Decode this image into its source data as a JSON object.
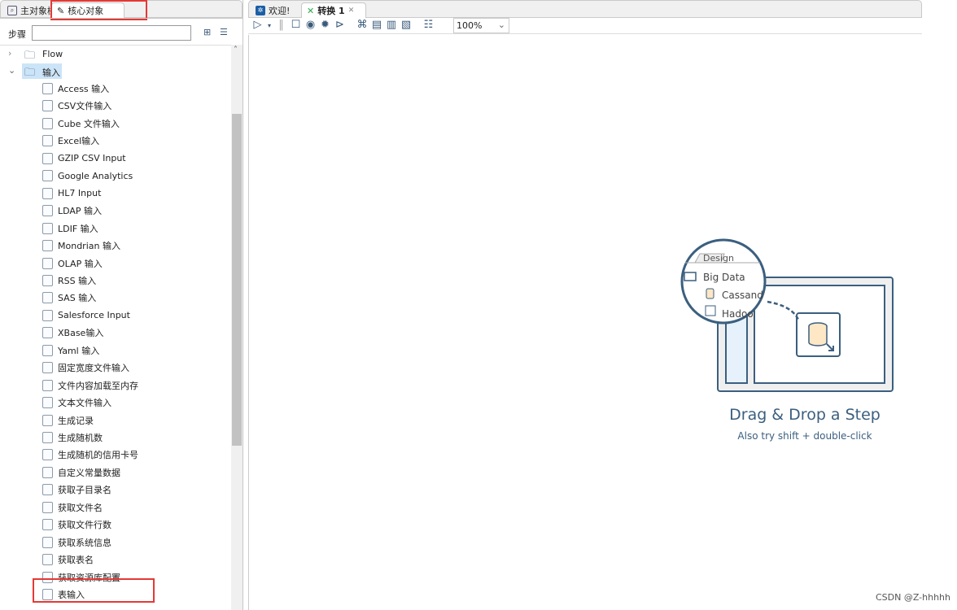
{
  "left_panel": {
    "tabs": [
      {
        "label": "主对象树",
        "icon": "search-doc-icon"
      },
      {
        "label": "核心对象",
        "icon": "pencil-icon"
      }
    ],
    "search_label": "步骤",
    "search_value": "",
    "tree": {
      "folders": [
        {
          "label": "Flow",
          "expanded": false
        },
        {
          "label": "输入",
          "expanded": true
        }
      ],
      "items": [
        "Access 输入",
        "CSV文件输入",
        "Cube 文件输入",
        "Excel输入",
        "GZIP CSV Input",
        "Google Analytics",
        "HL7 Input",
        "LDAP 输入",
        "LDIF 输入",
        "Mondrian 输入",
        "OLAP 输入",
        "RSS 输入",
        "SAS 输入",
        "Salesforce Input",
        "XBase输入",
        "Yaml 输入",
        "固定宽度文件输入",
        "文件内容加载至内存",
        "文本文件输入",
        "生成记录",
        "生成随机数",
        "生成随机的信用卡号",
        "自定义常量数据",
        "获取子目录名",
        "获取文件名",
        "获取文件行数",
        "获取系统信息",
        "获取表名",
        "获取资源库配置",
        "表输入"
      ]
    },
    "highlight_color": "#e53935"
  },
  "editor": {
    "tabs": [
      {
        "label": "欢迎!"
      },
      {
        "label": "转换 1",
        "active": true
      }
    ],
    "zoom": "100%",
    "toolbar": [
      "run",
      "run-dropdown",
      "pause",
      "stop",
      "preview",
      "debug",
      "replay",
      "verify",
      "impact",
      "sql",
      "explore-db",
      "show-results"
    ],
    "canvas_hint": {
      "design_tab": "Design",
      "folder": "Big Data",
      "step1": "Cassandra",
      "step2": "Hadoop",
      "title": "Drag & Drop a Step",
      "subtitle": "Also try shift + double-click"
    }
  },
  "watermark": "CSDN @Z-hhhhh",
  "accent": "#3b5f7f"
}
